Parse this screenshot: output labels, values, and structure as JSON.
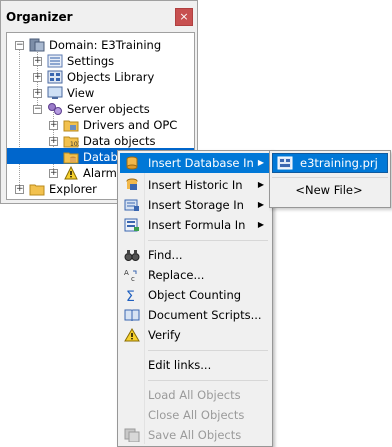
{
  "organizer": {
    "title": "Organizer",
    "close_glyph": "×",
    "tree": [
      {
        "label": "Domain: E3Training",
        "icon": "domain-icon",
        "expander": "−"
      },
      {
        "label": "Settings",
        "icon": "settings-icon",
        "expander": "+"
      },
      {
        "label": "Objects Library",
        "icon": "library-icon",
        "expander": "+"
      },
      {
        "label": "View",
        "icon": "view-icon",
        "expander": "+"
      },
      {
        "label": "Server objects",
        "icon": "server-objects-icon",
        "expander": "−"
      },
      {
        "label": "Drivers and OPC",
        "icon": "folder-icon",
        "expander": "+"
      },
      {
        "label": "Data objects",
        "icon": "folder-icon",
        "expander": "+"
      },
      {
        "label": "Databa",
        "icon": "database-folder-icon",
        "expander": ""
      },
      {
        "label": "Alarms",
        "icon": "alarm-icon",
        "expander": "+"
      },
      {
        "label": "Explorer",
        "icon": "folder-icon",
        "expander": "+"
      }
    ]
  },
  "context_menu": {
    "items": [
      {
        "label": "Insert Database In",
        "icon": "database-icon",
        "submenu": true,
        "highlighted": true
      },
      {
        "label": "Insert Historic In",
        "icon": "historic-icon",
        "submenu": true
      },
      {
        "label": "Insert Storage In",
        "icon": "storage-icon",
        "submenu": true
      },
      {
        "label": "Insert Formula In",
        "icon": "formula-icon",
        "submenu": true
      },
      {
        "label": "Find...",
        "icon": "binoculars-icon"
      },
      {
        "label": "Replace...",
        "icon": "replace-icon"
      },
      {
        "label": "Object Counting",
        "icon": "sigma-icon"
      },
      {
        "label": "Document Scripts...",
        "icon": "book-icon"
      },
      {
        "label": "Verify",
        "icon": "warning-icon"
      },
      {
        "label": "Edit links..."
      },
      {
        "label": "Load All Objects",
        "disabled": true
      },
      {
        "label": "Close All Objects",
        "disabled": true
      },
      {
        "label": "Save All Objects",
        "icon": "save-all-icon",
        "disabled": true
      }
    ],
    "arrow_glyph": "▶"
  },
  "submenu": {
    "project": "e3training.prj",
    "new_file": "<New File>"
  },
  "colors": {
    "highlight": "#0078d7",
    "tree_selection": "#0066cc",
    "close_button": "#c75050"
  }
}
